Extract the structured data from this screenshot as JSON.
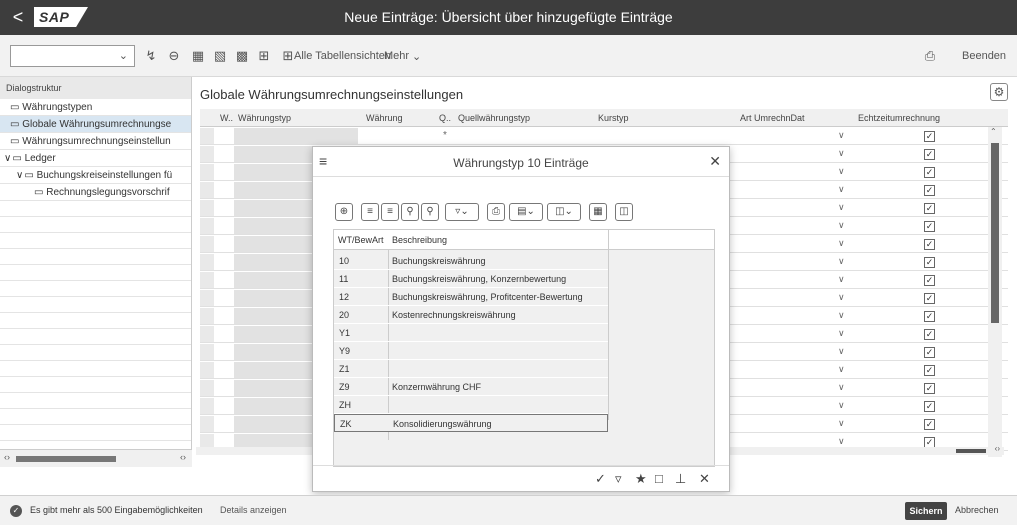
{
  "shell": {
    "back_label": "<",
    "logo": "SAP",
    "title": "Neue Einträge: Übersicht über hinzugefügte Einträge"
  },
  "toolbar": {
    "command_value": "",
    "alle_tabellensichten": "Alle Tabellensichten",
    "mehr": "Mehr",
    "beenden": "Beenden"
  },
  "sidebar": {
    "header": "Dialogstruktur",
    "items": [
      {
        "label": "Währungstypen",
        "depth": 0,
        "icon": "folder-icon",
        "selected": false
      },
      {
        "label": "Globale Währungsumrechnungse",
        "depth": 0,
        "icon": "folder-open-icon",
        "selected": true
      },
      {
        "label": "Währungsumrechnungseinstellun",
        "depth": 0,
        "icon": "folder-icon",
        "selected": false
      },
      {
        "label": "Ledger",
        "depth": 0,
        "icon": "folder-icon",
        "selected": false,
        "expanded": true
      },
      {
        "label": "Buchungskreiseinstellungen fü",
        "depth": 1,
        "icon": "folder-icon",
        "selected": false,
        "expanded": true
      },
      {
        "label": "Rechnungslegungsvorschrif",
        "depth": 2,
        "icon": "folder-icon",
        "selected": false
      }
    ]
  },
  "main": {
    "title": "Globale Währungsumrechnungseinstellungen",
    "columns": [
      "W..",
      "Währungstyp",
      "Währung",
      "Q..",
      "Quellwährungstyp",
      "Kurstyp",
      "Art UmrechnDat",
      "Echtzeitumrechnung"
    ],
    "first_row_marker": "*",
    "row_count": 18,
    "checked_count": 18
  },
  "dialog": {
    "title": "Währungstyp 10 Einträge",
    "columns": [
      "WT/BewArt",
      "Beschreibung"
    ],
    "rows": [
      {
        "key": "10",
        "desc": "Buchungskreiswährung"
      },
      {
        "key": "11",
        "desc": "Buchungskreiswährung, Konzernbewertung"
      },
      {
        "key": "12",
        "desc": "Buchungskreiswährung, Profitcenter-Bewertung"
      },
      {
        "key": "20",
        "desc": "Kostenrechnungskreiswährung"
      },
      {
        "key": "Y1",
        "desc": ""
      },
      {
        "key": "Y9",
        "desc": ""
      },
      {
        "key": "Z1",
        "desc": ""
      },
      {
        "key": "Z9",
        "desc": "Konzernwährung CHF"
      },
      {
        "key": "ZH",
        "desc": ""
      },
      {
        "key": "ZK",
        "desc": "Konsolidierungswährung"
      }
    ],
    "selected_row": "ZK"
  },
  "status": {
    "message": "Es gibt mehr als 500 Eingabemöglichkeiten",
    "details_link": "Details anzeigen",
    "save": "Sichern",
    "cancel": "Abbrechen"
  },
  "colors": {
    "shell_bg": "#3d3d3d",
    "selected_tree": "#d8e6f2",
    "save_button": "#444444"
  }
}
